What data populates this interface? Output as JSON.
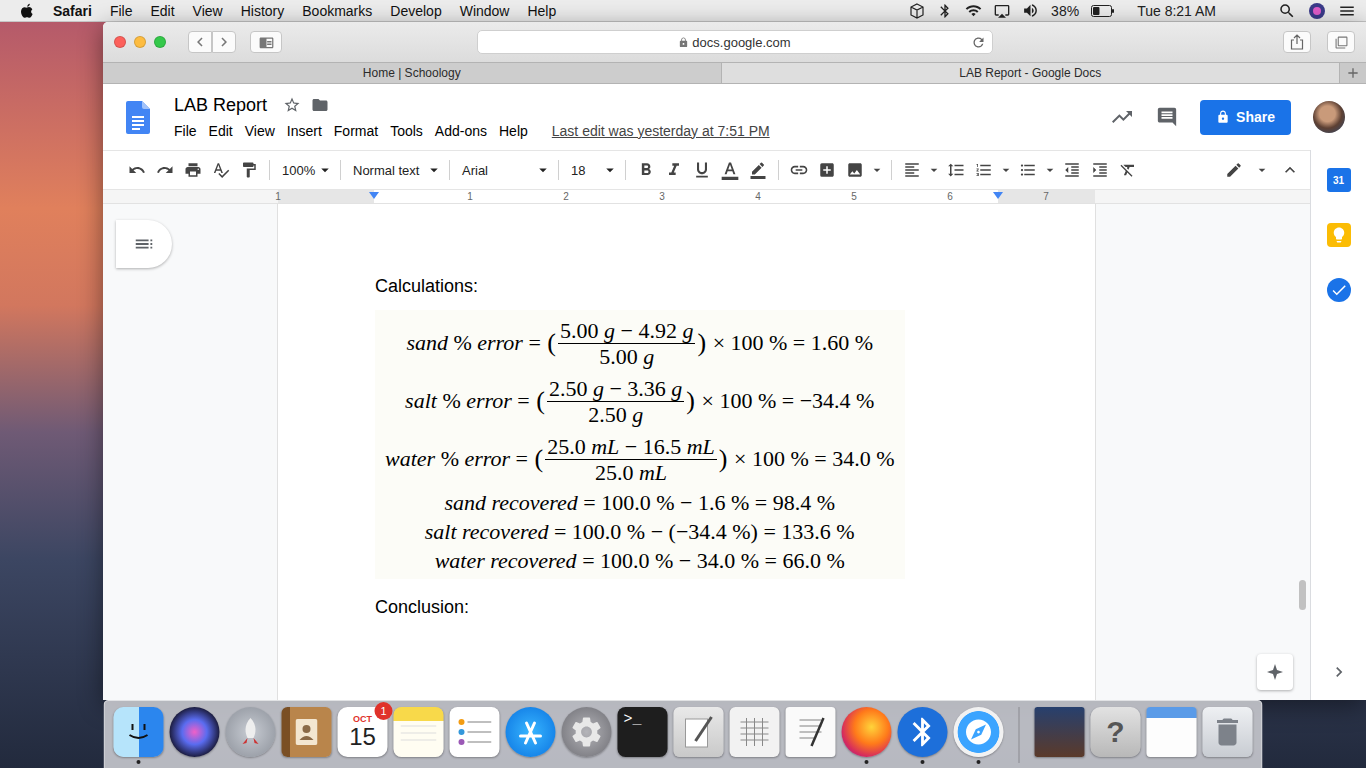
{
  "menubar": {
    "app": "Safari",
    "menus": [
      "File",
      "Edit",
      "View",
      "History",
      "Bookmarks",
      "Develop",
      "Window",
      "Help"
    ],
    "battery": "38%",
    "battery_level": 0.38,
    "clock": "Tue 8:21 AM"
  },
  "browser": {
    "address": "docs.google.com",
    "tabs": [
      {
        "label": "Home | Schoology",
        "selected": false
      },
      {
        "label": "LAB Report - Google Docs",
        "selected": true
      }
    ]
  },
  "docs": {
    "title": "LAB Report",
    "starred": false,
    "menus": [
      "File",
      "Edit",
      "View",
      "Insert",
      "Format",
      "Tools",
      "Add-ons",
      "Help"
    ],
    "last_edit": "Last edit was yesterday at 7:51 PM",
    "share": "Share",
    "toolbar": {
      "zoom": "100%",
      "style": "Normal text",
      "font": "Arial",
      "size": "18"
    },
    "ruler": {
      "left": [
        "1"
      ],
      "right": [
        "1",
        "2",
        "3",
        "4",
        "5",
        "6",
        "7"
      ]
    },
    "side_panel": [
      {
        "kind": "calendar",
        "glyph": "31"
      },
      {
        "kind": "keep"
      },
      {
        "kind": "tasks"
      }
    ]
  },
  "page": {
    "heading": "Calculations:",
    "equations": [
      {
        "kind": "fraction",
        "lhs": "sand % error =",
        "open": "(",
        "numerator": "5.00 g − 4.92 g",
        "denominator": "5.00 g",
        "close": ")",
        "rhs": "× 100 % = 1.60 %"
      },
      {
        "kind": "fraction",
        "lhs": "salt % error =",
        "open": "(",
        "numerator": "2.50 g − 3.36 g",
        "denominator": "2.50 g",
        "close": ")",
        "rhs": "× 100 % = −34.4 %"
      },
      {
        "kind": "fraction",
        "lhs": "water % error =",
        "open": "(",
        "numerator": "25.0 mL − 16.5 mL",
        "denominator": "25.0 mL",
        "close": ")",
        "rhs": "× 100 % = 34.0 %"
      },
      {
        "kind": "line",
        "text": "sand recovered = 100.0 % − 1.6 % = 98.4 %"
      },
      {
        "kind": "line",
        "text": "salt recovered = 100.0 % − (−34.4 %) = 133.6 %"
      },
      {
        "kind": "line",
        "text": "water recovered = 100.0 % − 34.0 % = 66.0 %"
      }
    ],
    "footer_heading": "Conclusion:"
  },
  "dock": [
    {
      "kind": "finder",
      "running": true
    },
    {
      "kind": "siri",
      "running": false
    },
    {
      "kind": "launchpad",
      "running": false
    },
    {
      "kind": "contacts",
      "running": false
    },
    {
      "kind": "calendar",
      "month": "OCT",
      "day": "15",
      "badge": "1",
      "running": false
    },
    {
      "kind": "notes",
      "running": false
    },
    {
      "kind": "reminders",
      "running": false
    },
    {
      "kind": "appstore",
      "running": false
    },
    {
      "kind": "settings",
      "running": false
    },
    {
      "kind": "terminal",
      "glyph": ">_",
      "running": false
    },
    {
      "kind": "preview",
      "running": false
    },
    {
      "kind": "grapher",
      "running": false
    },
    {
      "kind": "textedit",
      "running": false
    },
    {
      "kind": "firefox",
      "running": true
    },
    {
      "kind": "bluetooth",
      "running": true
    },
    {
      "kind": "safari",
      "running": true
    },
    {
      "kind": "separator"
    },
    {
      "kind": "book",
      "running": false
    },
    {
      "kind": "help",
      "glyph": "?",
      "running": false
    },
    {
      "kind": "files",
      "running": false
    },
    {
      "kind": "trash",
      "running": false
    }
  ]
}
